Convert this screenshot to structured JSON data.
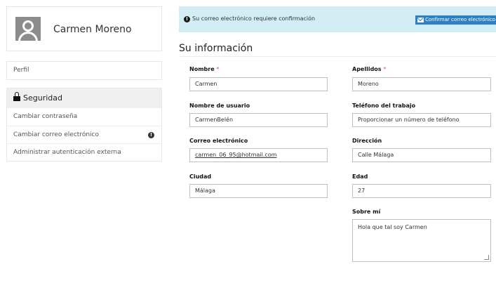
{
  "profile": {
    "name": "Carmen Moreno"
  },
  "sidebar": {
    "profile_link": "Perfil",
    "security_heading": "Seguridad",
    "items": [
      {
        "label": "Cambiar contraseña"
      },
      {
        "label": "Cambiar correo electrónico"
      },
      {
        "label": "Administrar autenticación externa"
      }
    ]
  },
  "alert": {
    "message": "Su correo electrónico requiere confirmación",
    "button_label": "Confirmar correo electrónico"
  },
  "section": {
    "title": "Su información"
  },
  "form": {
    "nombre": {
      "label": "Nombre",
      "required_mark": "*",
      "value": "Carmen"
    },
    "apellidos": {
      "label": "Apellidos",
      "required_mark": "*",
      "value": "Moreno"
    },
    "usuario": {
      "label": "Nombre de usuario",
      "value": "CarmenBelén"
    },
    "telefono": {
      "label": "Teléfono del trabajo",
      "value": "Proporcionar un número de teléfono"
    },
    "correo": {
      "label": "Correo electrónico",
      "value": "carmen_06_95@hotmail.com"
    },
    "direccion": {
      "label": "Dirección",
      "value": "Calle Málaga"
    },
    "ciudad": {
      "label": "Ciudad",
      "value": "Málaga"
    },
    "edad": {
      "label": "Edad",
      "value": "27"
    },
    "sobre": {
      "label": "Sobre mí",
      "value": "Hola que tal soy Carmen"
    }
  }
}
